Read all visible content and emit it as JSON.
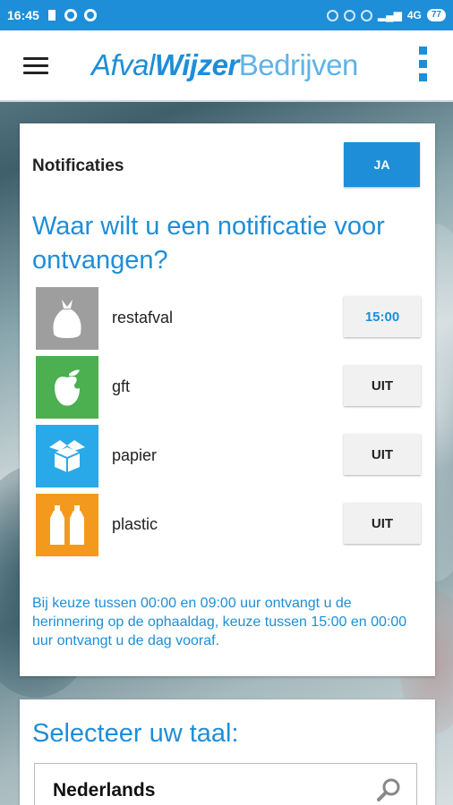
{
  "status_bar": {
    "time": "16:45",
    "network": "4G",
    "battery": "77"
  },
  "app_bar": {
    "logo_part1": "Afval",
    "logo_part2": "Wijzer",
    "logo_part3": "Bedrijven",
    "menu_icon": "hamburger-icon",
    "overflow_icon": "more-vert-icon"
  },
  "notifications": {
    "label": "Notificaties",
    "toggle": "JA",
    "question": "Waar wilt u een notificatie voor ontvangen?",
    "items": [
      {
        "name": "restafval",
        "value": "15:00",
        "color": "#9e9e9e",
        "icon": "trash-bag-icon"
      },
      {
        "name": "gft",
        "value": "UIT",
        "color": "#4caf50",
        "icon": "apple-core-icon"
      },
      {
        "name": "papier",
        "value": "UIT",
        "color": "#29a9e8",
        "icon": "box-icon"
      },
      {
        "name": "plastic",
        "value": "UIT",
        "color": "#f39a1e",
        "icon": "bottles-icon"
      }
    ],
    "info": "Bij keuze tussen 00:00 en 09:00 uur ontvangt u de herinnering op de ophaaldag, keuze tussen 15:00 en 00:00 uur ontvangt u de dag vooraf."
  },
  "language": {
    "title": "Selecteer uw taal:",
    "selected": "Nederlands"
  },
  "colors": {
    "accent": "#1e8ed8",
    "status_bar": "#1e8ed8"
  }
}
